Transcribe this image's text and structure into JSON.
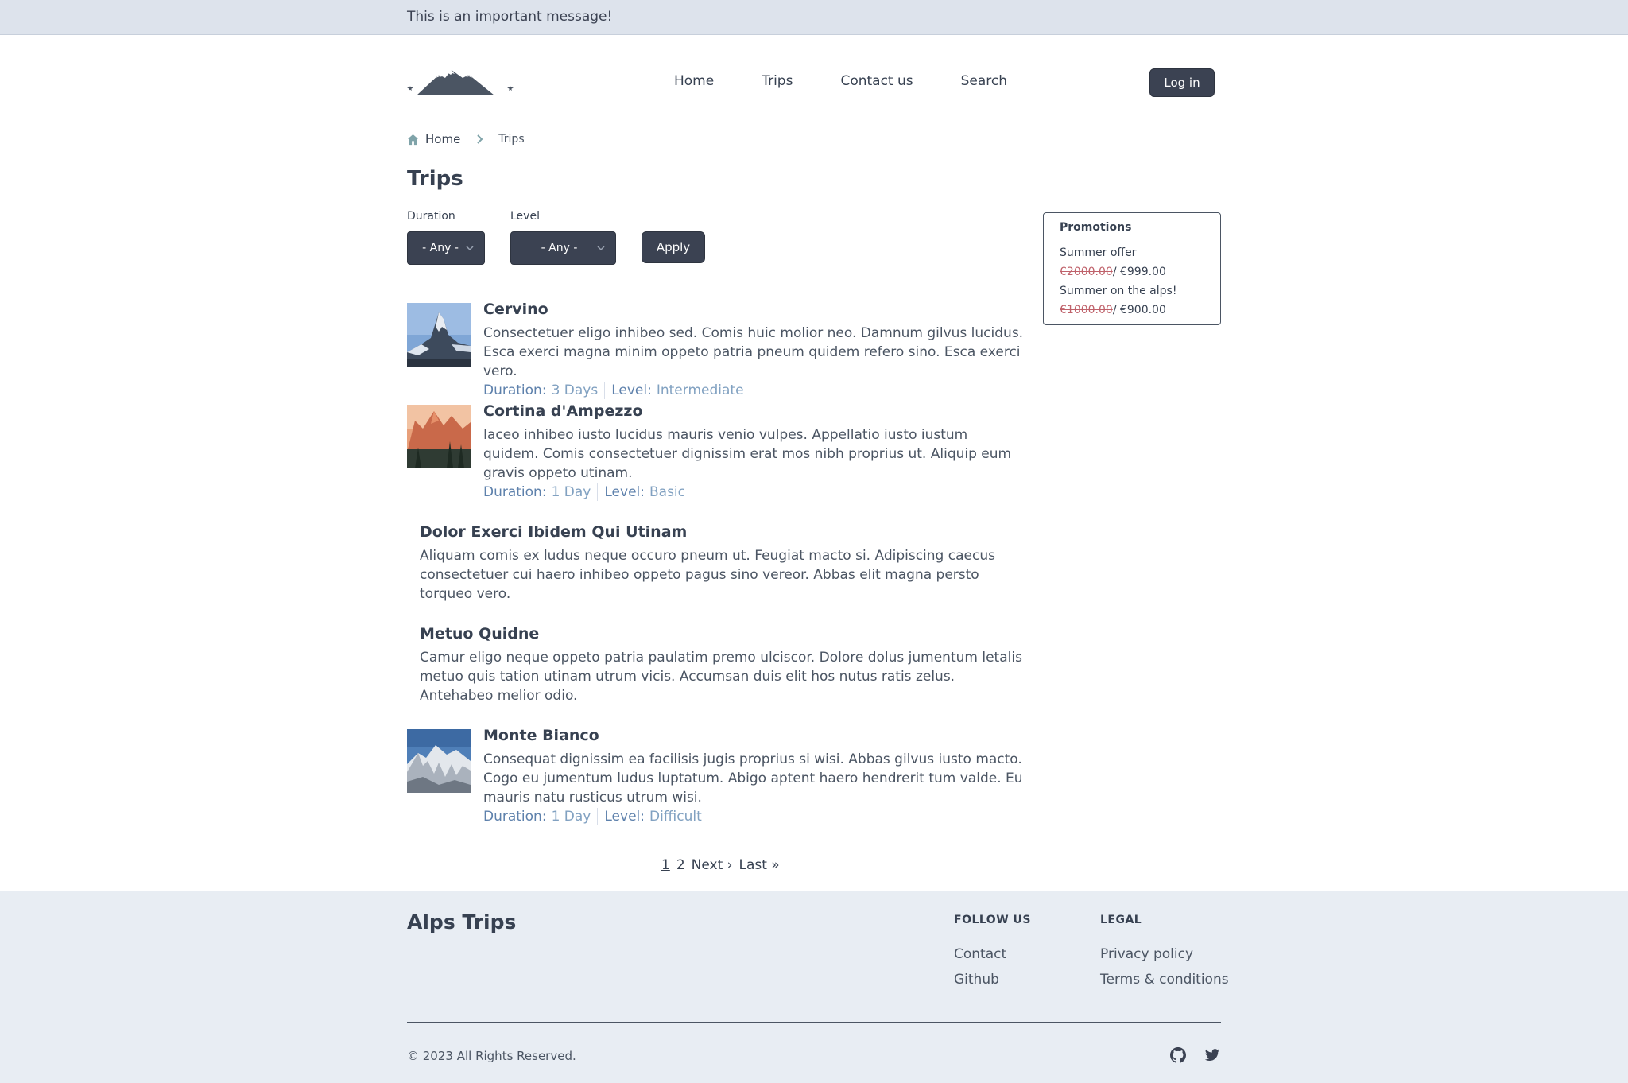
{
  "top_message": "This is an important message!",
  "nav": {
    "items": [
      "Home",
      "Trips",
      "Contact us",
      "Search"
    ],
    "login_label": "Log in"
  },
  "breadcrumb": {
    "home": "Home",
    "current": "Trips"
  },
  "page_title": "Trips",
  "filters": {
    "duration_label": "Duration",
    "duration_value": "- Any -",
    "level_label": "Level",
    "level_value": "- Any -",
    "apply_label": "Apply"
  },
  "trips": [
    {
      "title": "Cervino",
      "description": "Consectetuer eligo inhibeo sed. Comis huic molior neo. Damnum gilvus lucidus. Esca exerci magna minim oppeto patria pneum quidem refero sino. Esca exerci vero.",
      "duration_label": "Duration:",
      "duration": "3 Days",
      "level_label": "Level:",
      "level": "Intermediate",
      "image": "matterhorn"
    },
    {
      "title": "Cortina d'Ampezzo",
      "description": "Iaceo inhibeo iusto lucidus mauris venio vulpes. Appellatio iusto iustum quidem. Comis consectetuer dignissim erat mos nibh proprius ut. Aliquip eum gravis oppeto utinam.",
      "duration_label": "Duration:",
      "duration": "1 Day",
      "level_label": "Level:",
      "level": "Basic",
      "image": "dolomites"
    },
    {
      "title": "Dolor Exerci Ibidem Qui Utinam",
      "description": "Aliquam comis ex ludus neque occuro pneum ut. Feugiat macto si. Adipiscing caecus consectetuer cui haero inhibeo oppeto pagus sino vereor. Abbas elit magna persto torqueo vero."
    },
    {
      "title": "Metuo Quidne",
      "description": "Camur eligo neque oppeto patria paulatim premo ulciscor. Dolore dolus jumentum letalis metuo quis tation utinam utrum vicis. Accumsan duis elit hos nutus ratis zelus. Antehabeo melior odio."
    },
    {
      "title": "Monte Bianco",
      "description": "Consequat dignissim ea facilisis jugis proprius si wisi. Abbas gilvus iusto macto. Cogo eu jumentum ludus luptatum. Abigo aptent haero hendrerit tum valde. Eu mauris natu rusticus utrum wisi.",
      "duration_label": "Duration:",
      "duration": "1 Day",
      "level_label": "Level:",
      "level": "Difficult",
      "image": "mont-blanc"
    }
  ],
  "pager": {
    "current": "1",
    "page2": "2",
    "next": "Next ›",
    "last": "Last »"
  },
  "promotions": {
    "heading": "Promotions",
    "items": [
      {
        "name": "Summer offer",
        "old_price": "€2000.00",
        "new_price": "/ €999.00"
      },
      {
        "name": "Summer on the alps!",
        "old_price": "€1000.00",
        "new_price": "/ €900.00"
      }
    ]
  },
  "footer": {
    "brand": "Alps Trips",
    "follow_heading": "FOLLOW US",
    "follow_links": [
      "Contact",
      "Github"
    ],
    "legal_heading": "LEGAL",
    "legal_links": [
      "Privacy policy",
      "Terms & conditions"
    ],
    "copyright": "© 2023 All Rights Reserved.",
    "social_icons": [
      "github-icon",
      "twitter-icon"
    ]
  },
  "colors": {
    "topbar": "#dde3ec",
    "dark_button": "#3b4252",
    "meta_label": "#5e81ac",
    "meta_value": "#81a1c1",
    "old_price": "#bf616a",
    "footer_bg": "#e8edf3"
  }
}
